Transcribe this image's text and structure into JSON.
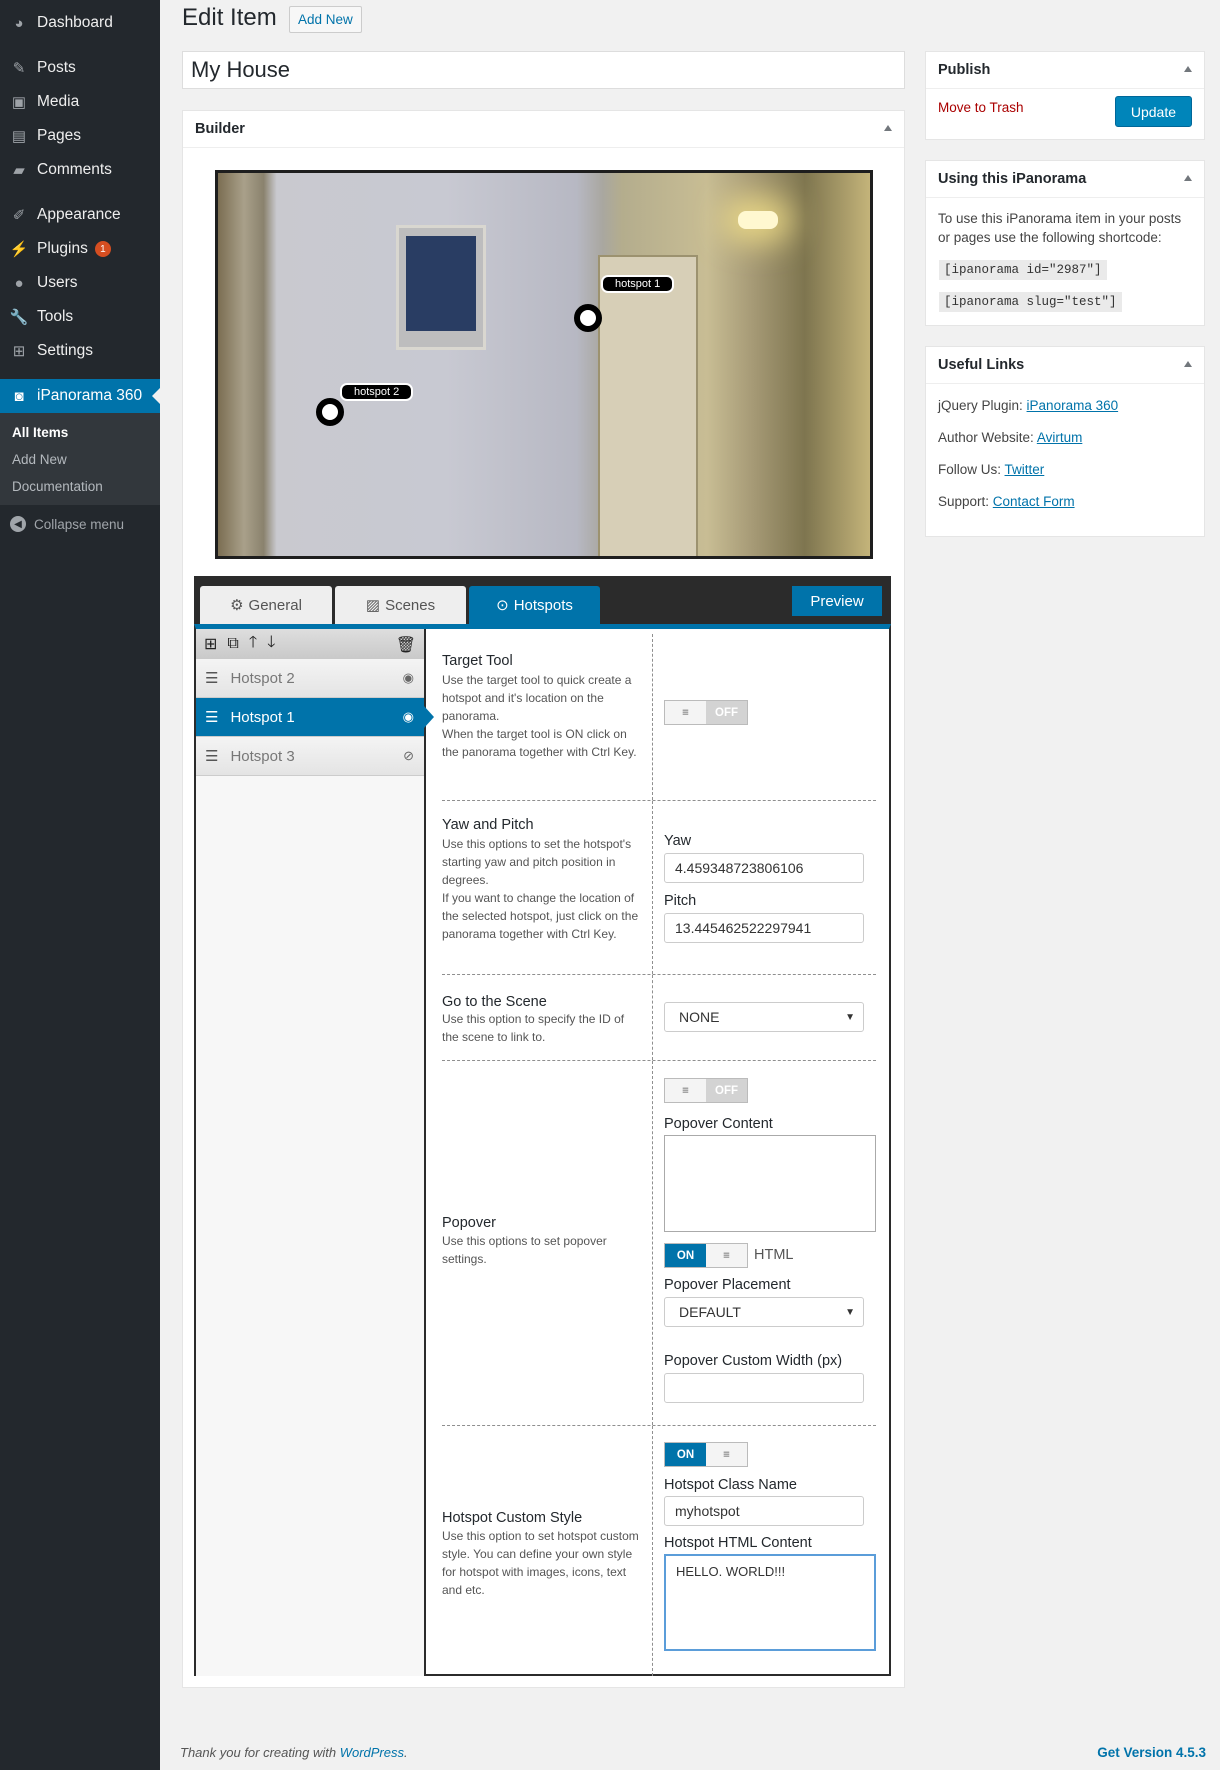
{
  "sidebar": {
    "items": [
      {
        "label": "Dashboard",
        "icon": "dashboard-icon"
      },
      {
        "label": "Posts",
        "icon": "pin-icon"
      },
      {
        "label": "Media",
        "icon": "media-icon"
      },
      {
        "label": "Pages",
        "icon": "page-icon"
      },
      {
        "label": "Comments",
        "icon": "comment-icon"
      },
      {
        "label": "Appearance",
        "icon": "brush-icon"
      },
      {
        "label": "Plugins",
        "icon": "plug-icon",
        "badge": "1"
      },
      {
        "label": "Users",
        "icon": "user-icon"
      },
      {
        "label": "Tools",
        "icon": "wrench-icon"
      },
      {
        "label": "Settings",
        "icon": "settings-icon"
      },
      {
        "label": "iPanorama 360",
        "icon": "panorama-icon"
      }
    ],
    "submenu": [
      "All Items",
      "Add New",
      "Documentation"
    ],
    "collapse": "Collapse menu"
  },
  "header": {
    "title": "Edit Item",
    "add_new": "Add New"
  },
  "item_title": "My House",
  "builder": {
    "title": "Builder",
    "hotspot_labels": [
      "hotspot 1",
      "hotspot 2"
    ],
    "tabs": [
      "General",
      "Scenes",
      "Hotspots"
    ],
    "preview": "Preview",
    "hotspots": [
      "Hotspot 2",
      "Hotspot 1",
      "Hotspot 3"
    ],
    "target_tool": {
      "title": "Target Tool",
      "desc": "Use the target tool to quick create a hotspot and it's location on the panorama.\nWhen the target tool is ON click on the panorama together with Ctrl Key.",
      "state": "OFF"
    },
    "yaw_pitch": {
      "title": "Yaw and Pitch",
      "desc": "Use this options to set the hotspot's starting yaw and pitch position in degrees.\nIf you want to change the location of the selected hotspot, just click on the panorama together with Ctrl Key.",
      "yaw_label": "Yaw",
      "yaw": "4.459348723806106",
      "pitch_label": "Pitch",
      "pitch": "13.445462522297941"
    },
    "goto_scene": {
      "title": "Go to the Scene",
      "desc": "Use this option to specify the ID of the scene to link to.",
      "value": "NONE"
    },
    "popover": {
      "title": "Popover",
      "desc": "Use this options to set popover settings.",
      "state": "OFF",
      "content_label": "Popover Content",
      "html_state": "ON",
      "html_label": "HTML",
      "placement_label": "Popover Placement",
      "placement": "DEFAULT",
      "width_label": "Popover Custom Width (px)",
      "width": ""
    },
    "custom_style": {
      "title": "Hotspot Custom Style",
      "desc": "Use this option to set hotspot custom style. You can define your own style for hotspot with images, icons, text and etc.",
      "state": "ON",
      "class_label": "Hotspot Class Name",
      "class_value": "myhotspot",
      "html_label": "Hotspot HTML Content",
      "html_value": "HELLO. WORLD!!!"
    }
  },
  "publish": {
    "title": "Publish",
    "trash": "Move to Trash",
    "update": "Update"
  },
  "using": {
    "title": "Using this iPanorama",
    "desc": "To use this iPanorama item in your posts or pages use the following shortcode:",
    "code1": "[ipanorama id=\"2987\"]",
    "code2": "[ipanorama slug=\"test\"]"
  },
  "links": {
    "title": "Useful Links",
    "items": [
      {
        "label": "jQuery Plugin: ",
        "link": "iPanorama 360"
      },
      {
        "label": "Author Website: ",
        "link": "Avirtum"
      },
      {
        "label": "Follow Us: ",
        "link": "Twitter"
      },
      {
        "label": "Support: ",
        "link": "Contact Form"
      }
    ]
  },
  "footer": {
    "text": "Thank you for creating with ",
    "link": "WordPress",
    "suffix": ".",
    "version": "Get Version 4.5.3"
  },
  "colors": {
    "sidebar": "#23282d",
    "accent": "#0073aa",
    "badge": "#d54e21"
  }
}
